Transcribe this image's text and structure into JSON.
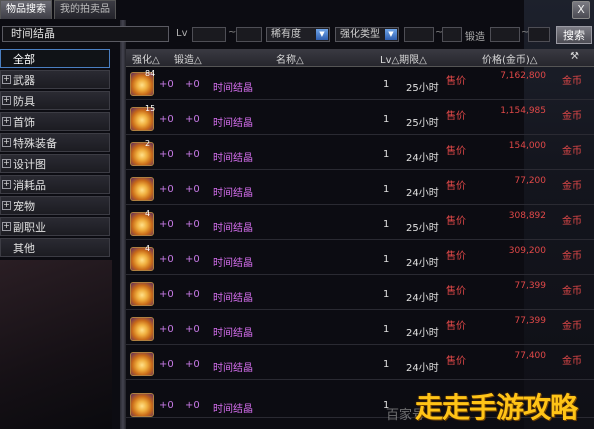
{
  "tabs": [
    {
      "label": "物品搜索",
      "active": true
    },
    {
      "label": "我的拍卖品",
      "active": false
    }
  ],
  "close_label": "X",
  "filters": {
    "search_value": "时间结晶",
    "lv_label": "Lv",
    "tilde": "~",
    "rarity": "稀有度",
    "enhance_type": "强化类型",
    "forge_label": "锻造",
    "search_button": "搜索"
  },
  "categories": [
    {
      "label": "全部",
      "expandable": false
    },
    {
      "label": "武器",
      "expandable": true
    },
    {
      "label": "防具",
      "expandable": true
    },
    {
      "label": "首饰",
      "expandable": true
    },
    {
      "label": "特殊装备",
      "expandable": true
    },
    {
      "label": "设计图",
      "expandable": true
    },
    {
      "label": "消耗品",
      "expandable": true
    },
    {
      "label": "宠物",
      "expandable": true
    },
    {
      "label": "副职业",
      "expandable": true
    },
    {
      "label": "其他",
      "expandable": false
    }
  ],
  "columns": {
    "enhance": "强化△",
    "forge": "锻造△",
    "name": "名称△",
    "lv_duration": "Lv△期限△",
    "price": "价格(金币)△"
  },
  "rows": [
    {
      "qty": "84",
      "enhance": "+0",
      "forge": "+0",
      "name": "时间结晶",
      "lv": "1",
      "duration": "25小时",
      "type": "售价",
      "price": "7,162,800",
      "unit": "金币"
    },
    {
      "qty": "15",
      "enhance": "+0",
      "forge": "+0",
      "name": "时间结晶",
      "lv": "1",
      "duration": "25小时",
      "type": "售价",
      "price": "1,154,985",
      "unit": "金币"
    },
    {
      "qty": "2",
      "enhance": "+0",
      "forge": "+0",
      "name": "时间结晶",
      "lv": "1",
      "duration": "24小时",
      "type": "售价",
      "price": "154,000",
      "unit": "金币"
    },
    {
      "qty": "",
      "enhance": "+0",
      "forge": "+0",
      "name": "时间结晶",
      "lv": "1",
      "duration": "24小时",
      "type": "售价",
      "price": "77,200",
      "unit": "金币"
    },
    {
      "qty": "4",
      "enhance": "+0",
      "forge": "+0",
      "name": "时间结晶",
      "lv": "1",
      "duration": "25小时",
      "type": "售价",
      "price": "308,892",
      "unit": "金币"
    },
    {
      "qty": "4",
      "enhance": "+0",
      "forge": "+0",
      "name": "时间结晶",
      "lv": "1",
      "duration": "24小时",
      "type": "售价",
      "price": "309,200",
      "unit": "金币"
    },
    {
      "qty": "",
      "enhance": "+0",
      "forge": "+0",
      "name": "时间结晶",
      "lv": "1",
      "duration": "24小时",
      "type": "售价",
      "price": "77,399",
      "unit": "金币"
    },
    {
      "qty": "",
      "enhance": "+0",
      "forge": "+0",
      "name": "时间结晶",
      "lv": "1",
      "duration": "24小时",
      "type": "售价",
      "price": "77,399",
      "unit": "金币"
    },
    {
      "qty": "",
      "enhance": "+0",
      "forge": "+0",
      "name": "时间结晶",
      "lv": "1",
      "duration": "24小时",
      "type": "售价",
      "price": "77,400",
      "unit": "金币"
    },
    {
      "qty": "",
      "enhance": "+0",
      "forge": "+0",
      "name": "时间结晶",
      "lv": "1",
      "duration": "",
      "type": "",
      "price": "",
      "unit": ""
    }
  ],
  "watermark": {
    "small": "百家号",
    "big": "走走手游攻略"
  }
}
